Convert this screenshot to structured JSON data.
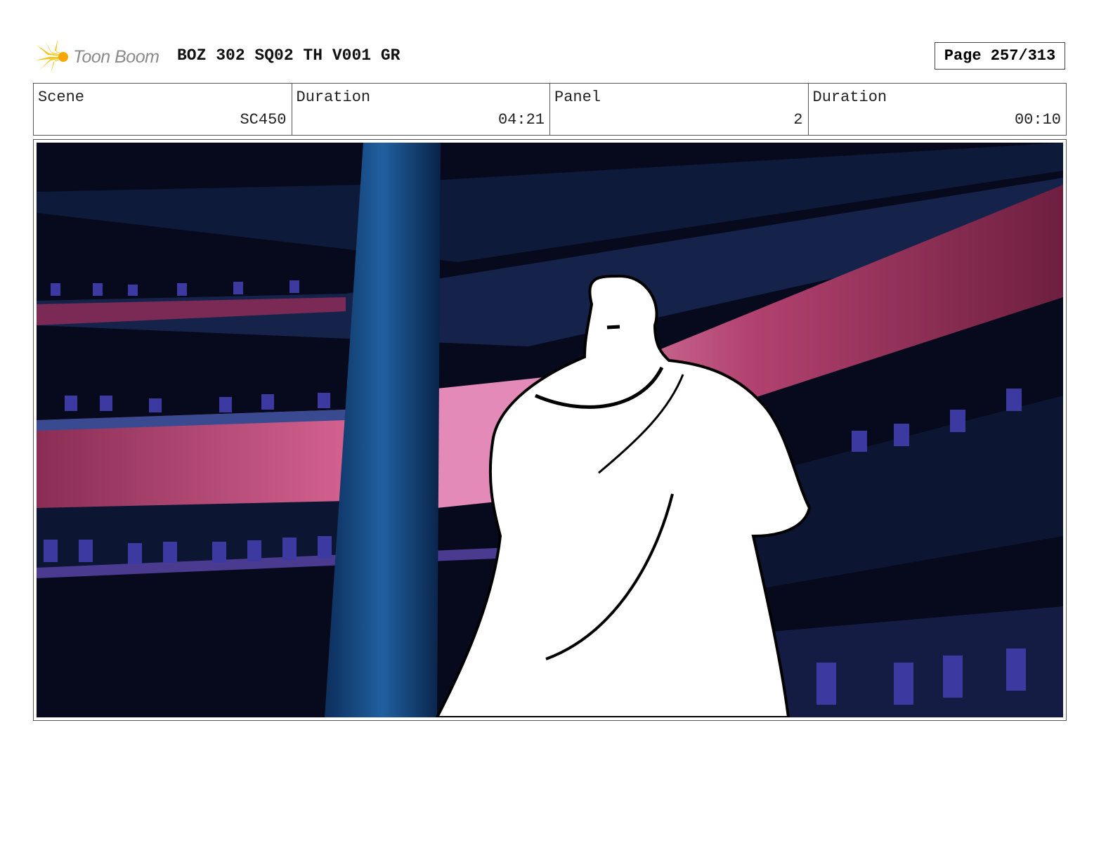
{
  "header": {
    "logo_text": "Toon Boom",
    "title": "BOZ 302 SQ02 TH V001 GR",
    "page": "Page 257/313"
  },
  "info": [
    {
      "label": "Scene",
      "value": "SC450"
    },
    {
      "label": "Duration",
      "value": "04:21"
    },
    {
      "label": "Panel",
      "value": "2"
    },
    {
      "label": "Duration",
      "value": "00:10"
    }
  ],
  "colors": {
    "logo_yellow": "#f5c518",
    "bg_navy": "#070a1c",
    "pink": "#c8507f",
    "column_blue": "#1d4f8c"
  }
}
